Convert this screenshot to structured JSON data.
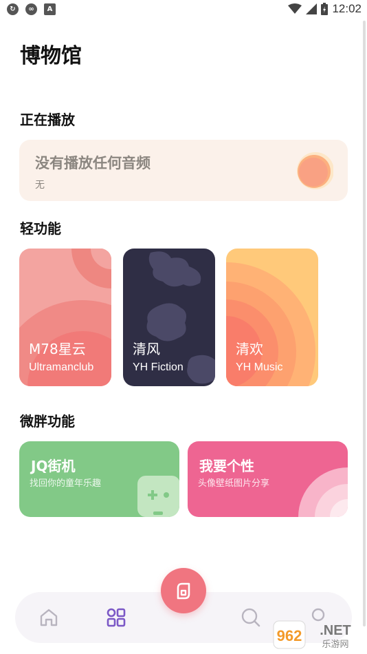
{
  "status_bar": {
    "time": "12:02"
  },
  "page": {
    "title": "博物馆"
  },
  "now_playing": {
    "section_title": "正在播放",
    "title": "没有播放任何音频",
    "subtitle": "无"
  },
  "lite_features": {
    "section_title": "轻功能",
    "cards": [
      {
        "name": "M78星云",
        "en": "Ultramanclub",
        "color": "#f3a4a0"
      },
      {
        "name": "清风",
        "en": "YH Fiction",
        "color": "#2f2e45"
      },
      {
        "name": "清欢",
        "en": "YH Music",
        "color": "#ffc97a"
      }
    ]
  },
  "weipang_features": {
    "section_title": "微胖功能",
    "cards": [
      {
        "title": "JQ街机",
        "desc": "找回你的童年乐趣",
        "color": "#82c987"
      },
      {
        "title": "我要个性",
        "desc": "头像壁纸图片分享",
        "color": "#ee6592"
      }
    ]
  },
  "bottom_nav": {
    "items": [
      {
        "icon": "home-icon"
      },
      {
        "icon": "grid-icon",
        "active_color": "#7b58c6"
      },
      {
        "icon": "search-icon"
      },
      {
        "icon": "profile-icon"
      }
    ],
    "fab_icon": "library-icon"
  },
  "watermark": {
    "text": "962.NET",
    "sub": "乐游网"
  }
}
